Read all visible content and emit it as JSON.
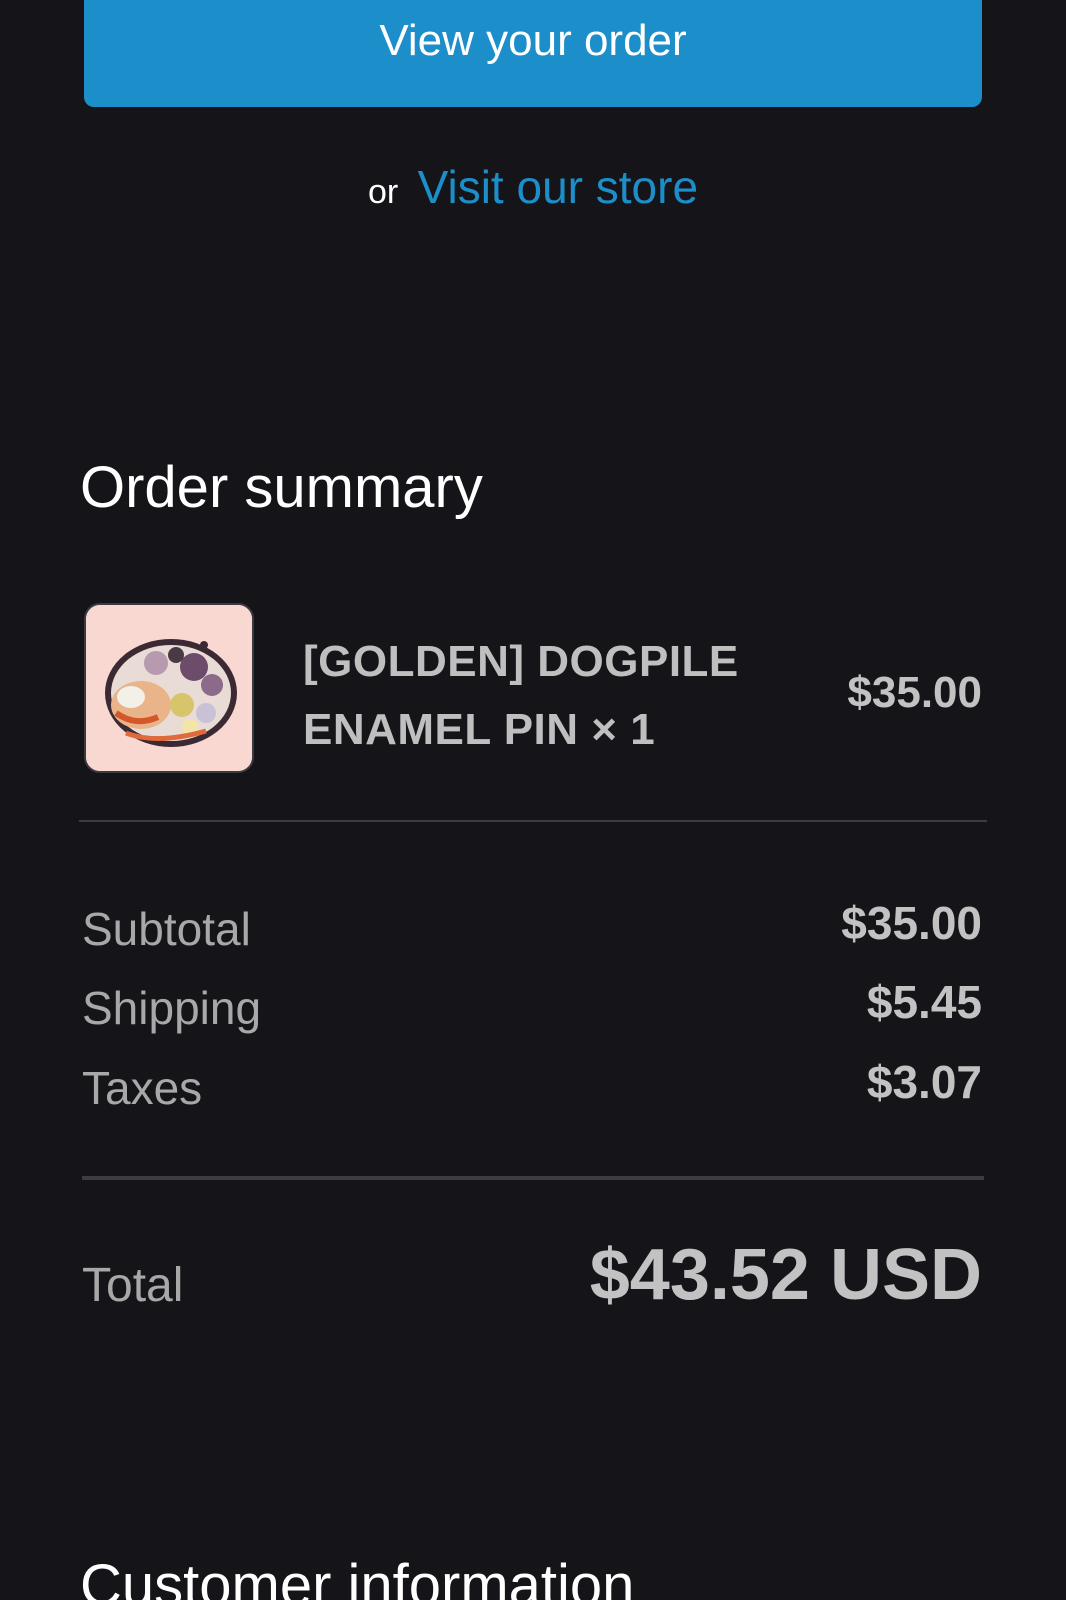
{
  "actions": {
    "view_order_label": "View your order",
    "or_text": "or",
    "visit_store_label": "Visit our store"
  },
  "order_summary": {
    "title": "Order summary",
    "items": [
      {
        "name": "[GOLDEN] DOGPILE ENAMEL PIN × 1",
        "price": "$35.00",
        "thumbnail_icon": "enamel-pin-image"
      }
    ],
    "lines": {
      "subtotal_label": "Subtotal",
      "subtotal_value": "$35.00",
      "shipping_label": "Shipping",
      "shipping_value": "$5.45",
      "taxes_label": "Taxes",
      "taxes_value": "$3.07"
    },
    "total_label": "Total",
    "total_value": "$43.52 USD"
  },
  "customer_information": {
    "title": "Customer information"
  },
  "colors": {
    "background": "#151519",
    "accent": "#1c8ec9",
    "muted_text": "#a8a8a8",
    "value_text": "#c2c2c2"
  }
}
